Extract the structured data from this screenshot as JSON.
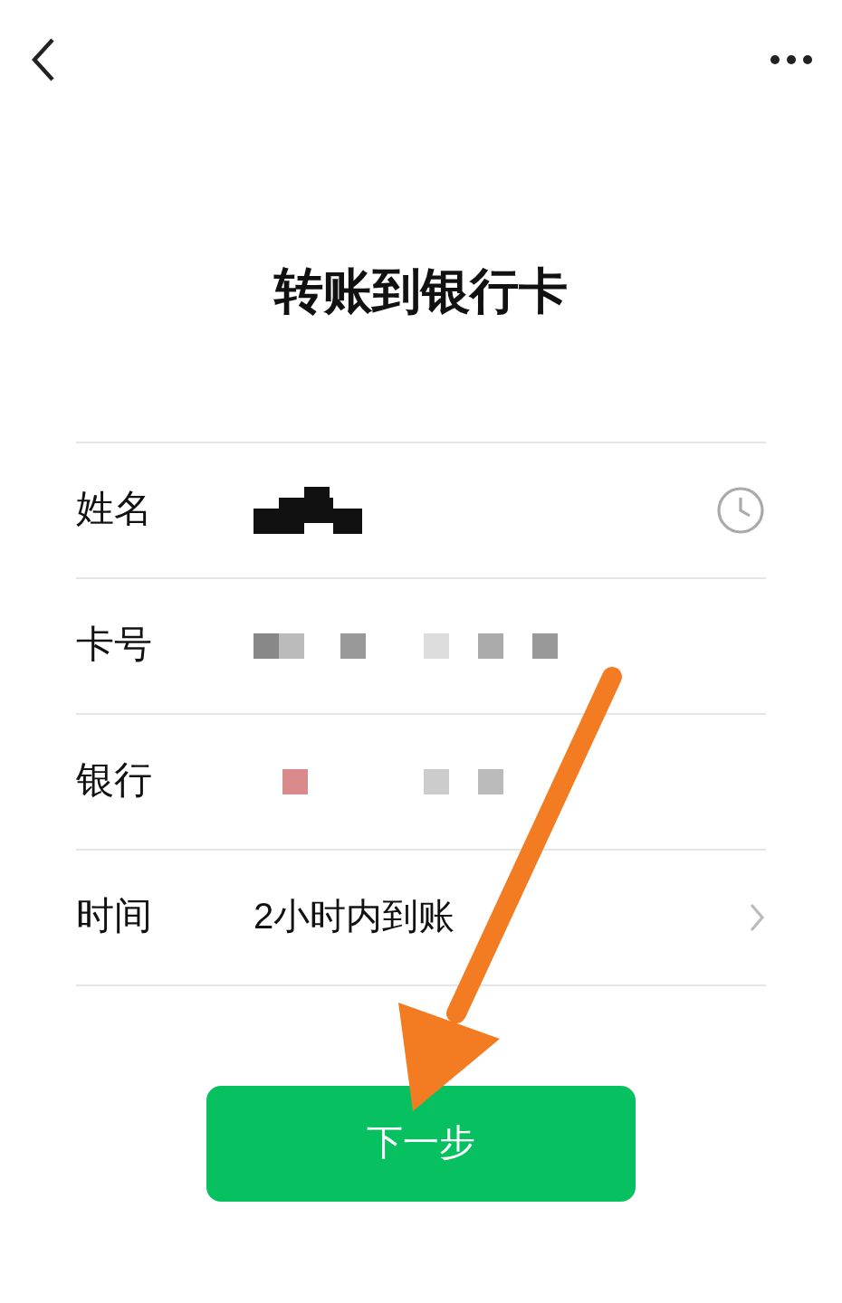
{
  "title": "转账到银行卡",
  "rows": [
    {
      "label": "姓名",
      "kind": "name"
    },
    {
      "label": "卡号",
      "kind": "card"
    },
    {
      "label": "银行",
      "kind": "bank"
    },
    {
      "label": "时间",
      "kind": "time",
      "value": "2小时内到账"
    }
  ],
  "next_button": "下一步"
}
